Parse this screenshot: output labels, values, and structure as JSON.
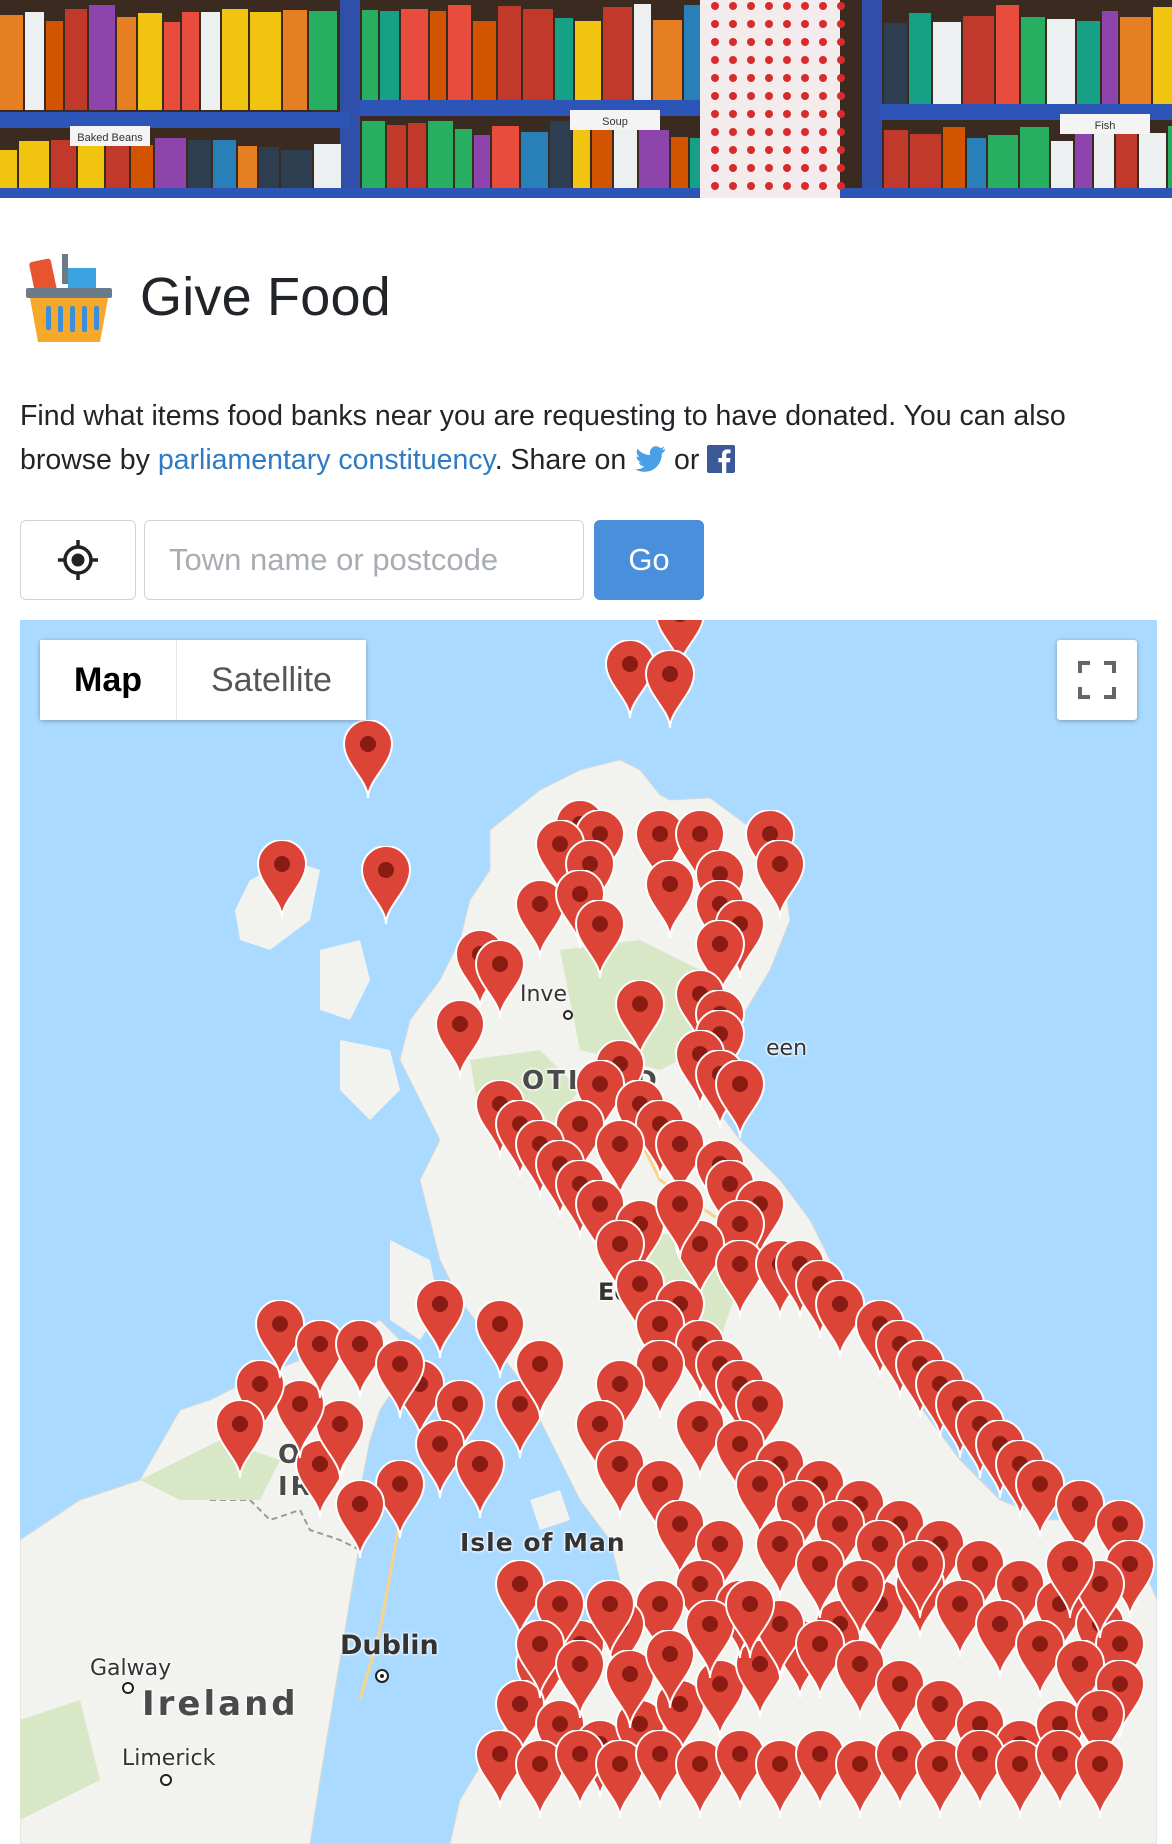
{
  "hero": {
    "shelf_labels": [
      "Baked Beans",
      "Soup",
      "Fish"
    ]
  },
  "brand": {
    "title": "Give Food",
    "logo_icon": "basket-icon"
  },
  "intro": {
    "text_before_link": "Find what items food banks near you are requesting to have donated. You can also browse by ",
    "link_text": "parliamentary constituency",
    "text_share": ". Share on ",
    "text_or": " or ",
    "twitter_icon": "twitter-icon",
    "facebook_icon": "facebook-icon"
  },
  "search": {
    "locate_icon": "crosshair-icon",
    "placeholder": "Town name or postcode",
    "value": "",
    "go_label": "Go"
  },
  "map": {
    "type_controls": [
      "Map",
      "Satellite"
    ],
    "active_type": "Map",
    "fullscreen_icon": "fullscreen-icon",
    "labels": {
      "inverness": "Inve",
      "scotland": "OTLAND",
      "aberdeen": "een",
      "edinburgh": "Edin",
      "northern_ireland_1": "OR",
      "northern_ireland_2": "IRE",
      "isle_of_man": "Isle of Man",
      "dublin": "Dublin",
      "galway": "Galway",
      "ireland": "Ireland",
      "limerick": "Limerick"
    },
    "colors": {
      "sea": "#aadaff",
      "land": "#f2f2ef",
      "park": "#d8e8c6",
      "pin": "#db4437",
      "pin_dot": "#8a1b12"
    }
  }
}
